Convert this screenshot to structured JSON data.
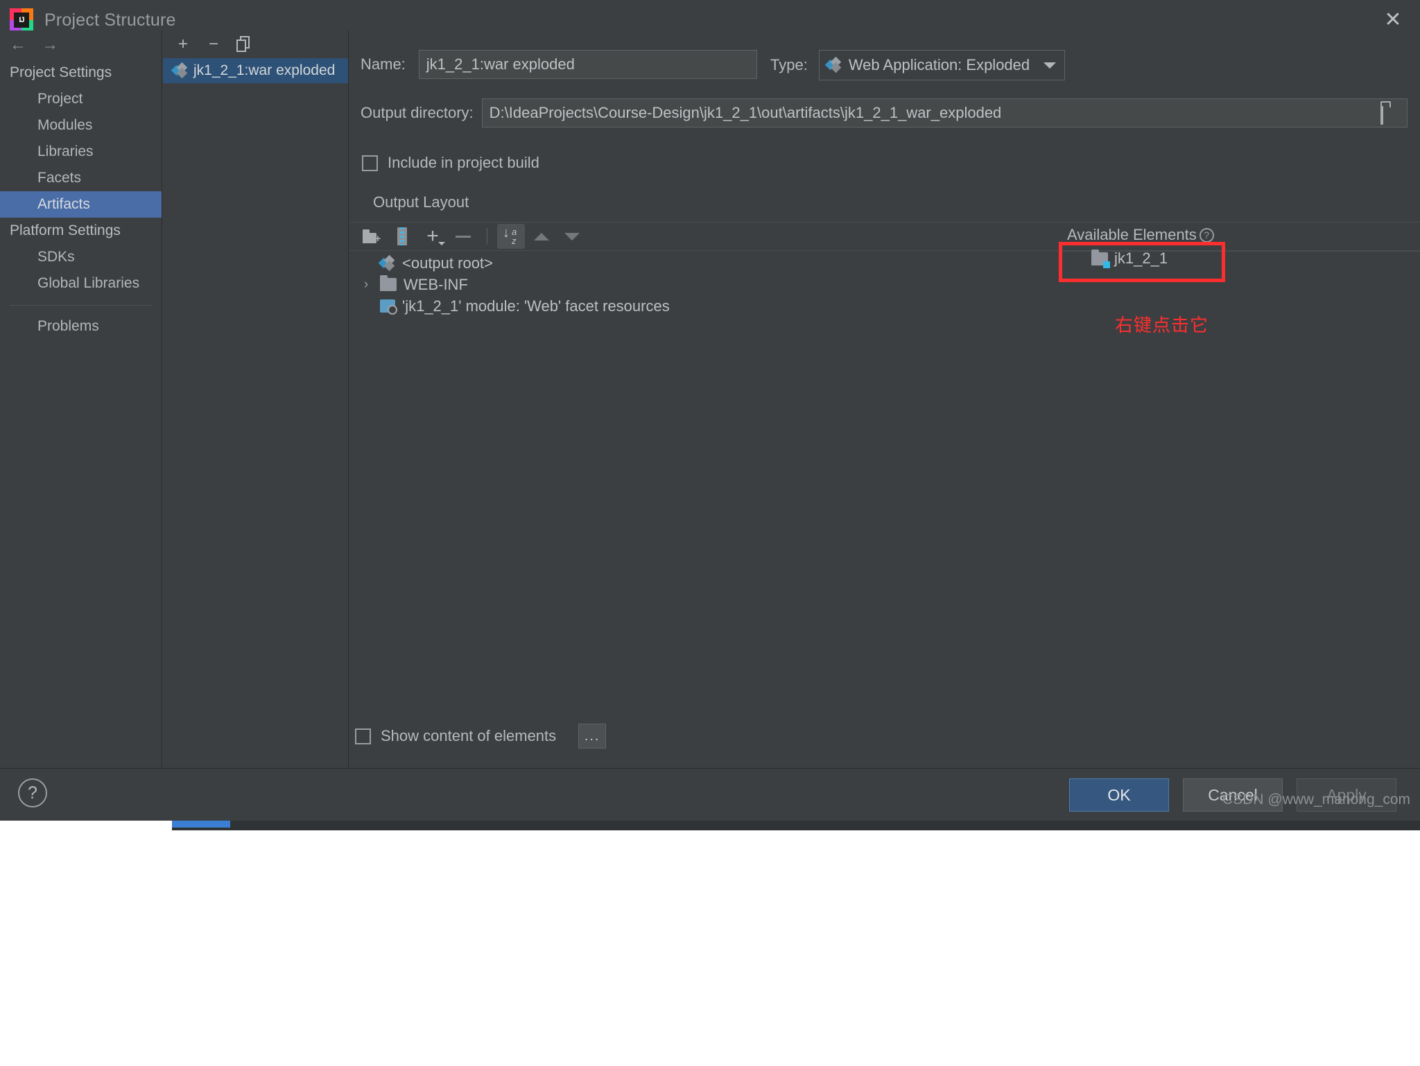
{
  "window": {
    "title": "Project Structure",
    "logo_text": "IJ",
    "close_label": "✕"
  },
  "sidebar": {
    "back_arrow": "←",
    "forward_arrow": "→",
    "groups": [
      {
        "label": "Project Settings",
        "items": [
          "Project",
          "Modules",
          "Libraries",
          "Facets",
          "Artifacts"
        ]
      },
      {
        "label": "Platform Settings",
        "items": [
          "SDKs",
          "Global Libraries"
        ]
      }
    ],
    "selected": "Artifacts",
    "problems_label": "Problems"
  },
  "artifact_panel": {
    "toolbar": {
      "add_label": "+",
      "remove_label": "−",
      "copy_label": "copy-icon"
    },
    "items": [
      {
        "label": "jk1_2_1:war exploded",
        "selected": true
      }
    ]
  },
  "main": {
    "name_label": "Name:",
    "name_value": "jk1_2_1:war exploded",
    "type_label": "Type:",
    "type_value": "Web Application: Exploded",
    "output_dir_label": "Output directory:",
    "output_dir_value": "D:\\IdeaProjects\\Course-Design\\jk1_2_1\\out\\artifacts\\jk1_2_1_war_exploded",
    "include_build_label": "Include in project build",
    "include_build_checked": false,
    "output_layout_label": "Output Layout",
    "layout_toolbar": [
      "create-directory-icon",
      "create-archive-icon",
      "add-icon",
      "remove-icon",
      "sort-alphabetically-icon",
      "move-up-icon",
      "move-down-icon"
    ],
    "tree": [
      {
        "label": "<output root>",
        "icon": "artifact-icon",
        "chevron": "",
        "indent": 0
      },
      {
        "label": "WEB-INF",
        "icon": "folder-icon",
        "chevron": "›",
        "indent": 1
      },
      {
        "label": "'jk1_2_1' module: 'Web' facet resources",
        "icon": "facet-icon",
        "chevron": "",
        "indent": 1
      }
    ],
    "available_elements_label": "Available Elements",
    "available_help_glyph": "?",
    "available_items": [
      {
        "label": "jk1_2_1",
        "icon": "module-folder-icon",
        "highlighted": true
      }
    ],
    "annotation_text": "右键点击它",
    "annotation_color": "#ff2e2e",
    "show_content_label": "Show content of elements",
    "show_content_checked": false,
    "ellipsis_button_label": "..."
  },
  "footer": {
    "help_glyph": "?",
    "ok_label": "OK",
    "cancel_label": "Cancel",
    "apply_label": "Apply"
  },
  "watermark": "CSDN @www_manong_com"
}
